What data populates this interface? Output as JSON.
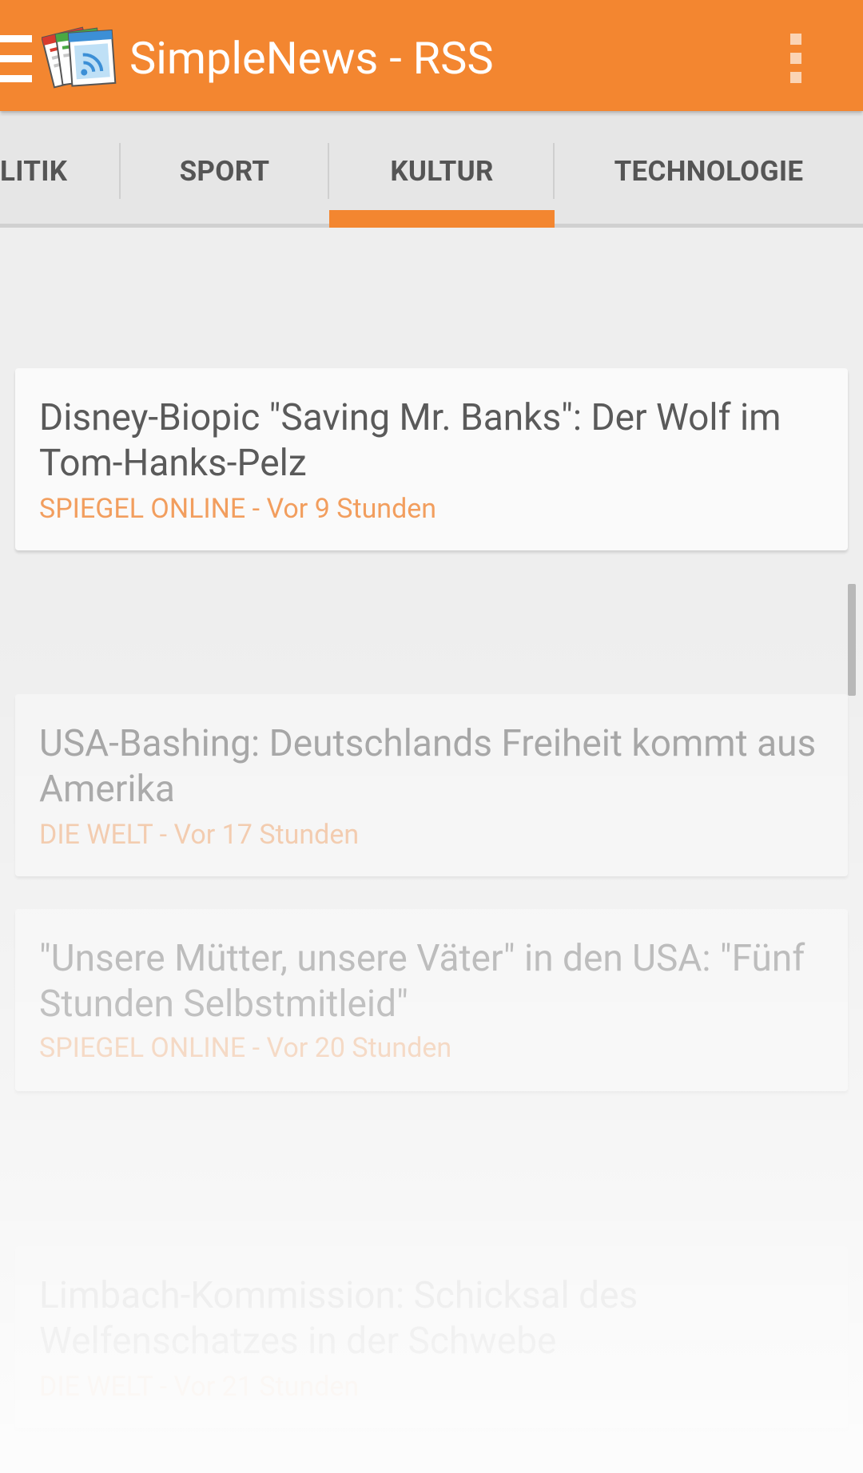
{
  "app_bar": {
    "title": "SimpleNews - RSS",
    "menu_icon": "hamburger-menu-icon",
    "logo_icon": "simplenews-logo-icon",
    "overflow_icon": "overflow-menu-icon",
    "background_color": "#f38630"
  },
  "tabs": [
    {
      "label": "LITIK",
      "selected": false
    },
    {
      "label": "SPORT",
      "selected": false
    },
    {
      "label": "KULTUR",
      "selected": true
    },
    {
      "label": "TECHNOLOGIE",
      "selected": false
    }
  ],
  "articles": [
    {
      "title": "Disney-Biopic \"Saving Mr. Banks\": Der Wolf im Tom-Hanks-Pelz",
      "meta": "SPIEGEL ONLINE - Vor 9 Stunden"
    },
    {
      "title": "USA-Bashing: Deutschlands Freiheit kommt aus Amerika",
      "meta": "DIE WELT - Vor 17 Stunden"
    },
    {
      "title": "\"Unsere Mütter, unsere Väter\" in den USA: \"Fünf Stunden Selbstmitleid\"",
      "meta": "SPIEGEL ONLINE - Vor 20 Stunden"
    },
    {
      "title": "Limbach-Kommission: Schicksal des Welfenschatzes in der Schwebe",
      "meta": "DIE WELT - Vor 21 Stunden"
    }
  ],
  "colors": {
    "accent": "#f38630",
    "meta_text": "#f29e5e",
    "title_text": "#5a5a5a"
  }
}
